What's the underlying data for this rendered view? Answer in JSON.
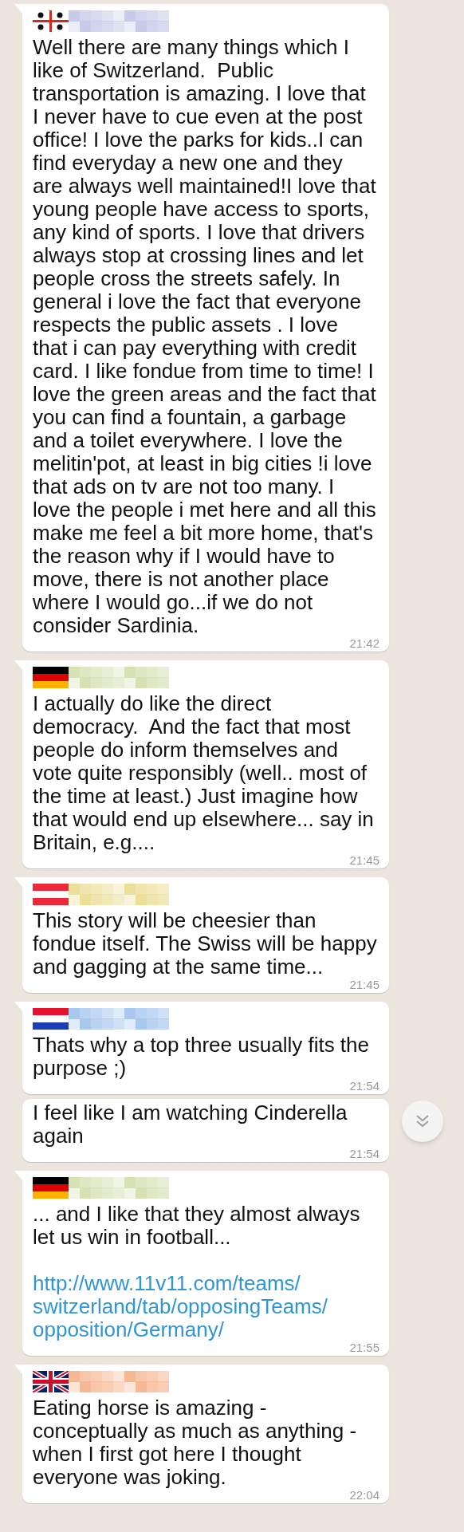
{
  "messages": [
    {
      "kind": "sardinia",
      "color": "#c7cbe8",
      "tail": true,
      "text": "Well there are many things which I like of Switzerland.  Public transportation is amazing. I love that I never have to cue even at the post office! I love the parks for kids..I can find everyday a new one and they are always well maintained!I love that young people have access to sports, any kind of sports. I love that drivers always stop at crossing lines and let people cross the streets safely. In general i love the fact that everyone respects the public assets . I love that i can pay everything with credit card. I like fondue from time to time! I love the green areas and the fact that you can find a fountain, a garbage and a toilet everywhere. I love the melitin'pot, at least in big cities !i love that ads on tv are not too many. I love the people i met here and all this make me feel a bit more home, that's the reason why if I would have to move, there is not another place where I would go...if we do not consider Sardinia.",
      "time": "21:42"
    },
    {
      "kind": "germany",
      "color": "#d6e2b4",
      "tail": true,
      "text": "I actually do like the direct democracy.  And the fact that most people do inform themselves and vote quite responsibly (well.. most of the time at least.) Just imagine how that would end up elsewhere... say in Britain, e.g....",
      "time": "21:45"
    },
    {
      "kind": "austria",
      "color": "#ecdf9a",
      "tail": true,
      "text": "This story will be cheesier than fondue itself. The Swiss will be happy and gagging at the same time...",
      "time": "21:45"
    },
    {
      "kind": "netherlands",
      "color": "#a9c8f0",
      "tail": true,
      "text": "Thats why a top three usually fits the purpose ;)",
      "time": "21:54"
    },
    {
      "tail": false,
      "text": "I feel like I am watching Cinderella again",
      "time": "21:54"
    },
    {
      "kind": "germany",
      "color": "#d6e2b4",
      "tail": true,
      "text": "... and I like that they almost always let us win in football...",
      "link": "http://www.11v11.com/teams/switzerland/tab/opposingTeams/opposition/Germany/",
      "time": "21:55"
    },
    {
      "kind": "uk",
      "color": "#f6b894",
      "tail": true,
      "text": "Eating horse is amazing - conceptually as much as anything - when I first got here I thought everyone was joking.",
      "time": "22:04"
    }
  ]
}
